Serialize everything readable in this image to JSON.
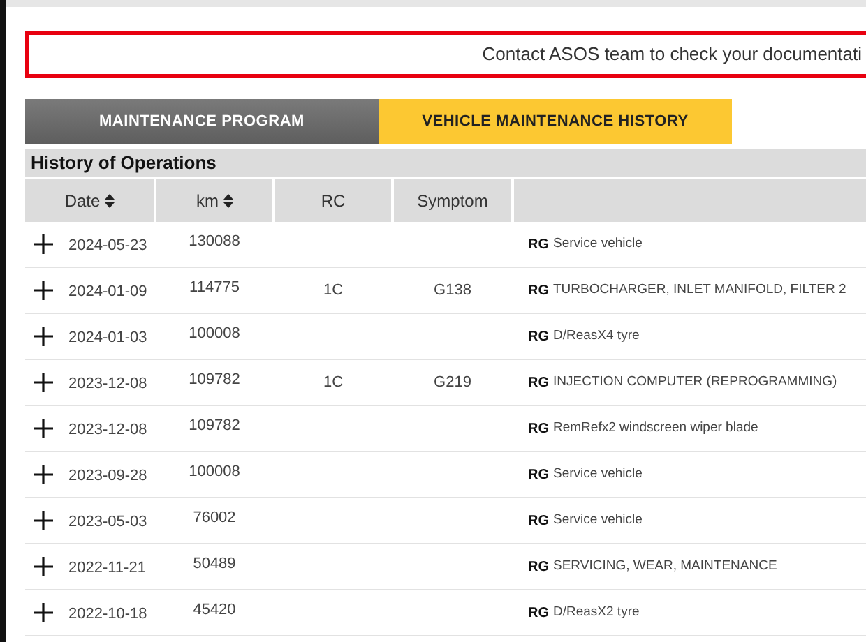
{
  "notice": "Contact ASOS team to check your documentati",
  "tabs": [
    {
      "label": "MAINTENANCE PROGRAM",
      "selected": false
    },
    {
      "label": "VEHICLE MAINTENANCE HISTORY",
      "selected": true
    }
  ],
  "section_title": "History of Operations",
  "table": {
    "columns": [
      {
        "label": "Date",
        "sortable": true
      },
      {
        "label": "km",
        "sortable": true
      },
      {
        "label": "RC",
        "sortable": false
      },
      {
        "label": "Symptom",
        "sortable": false
      }
    ],
    "rows": [
      {
        "date": "2024-05-23",
        "km": "130088",
        "rc": "",
        "symptom": "",
        "tag": "RG",
        "operation": "Service vehicle"
      },
      {
        "date": "2024-01-09",
        "km": "114775",
        "rc": "1C",
        "symptom": "G138",
        "tag": "RG",
        "operation": "TURBOCHARGER, INLET MANIFOLD, FILTER 2"
      },
      {
        "date": "2024-01-03",
        "km": "100008",
        "rc": "",
        "symptom": "",
        "tag": "RG",
        "operation": "D/ReasX4 tyre"
      },
      {
        "date": "2023-12-08",
        "km": "109782",
        "rc": "1C",
        "symptom": "G219",
        "tag": "RG",
        "operation": "INJECTION COMPUTER (REPROGRAMMING)"
      },
      {
        "date": "2023-12-08",
        "km": "109782",
        "rc": "",
        "symptom": "",
        "tag": "RG",
        "operation": "RemRefx2 windscreen wiper blade"
      },
      {
        "date": "2023-09-28",
        "km": "100008",
        "rc": "",
        "symptom": "",
        "tag": "RG",
        "operation": "Service vehicle"
      },
      {
        "date": "2023-05-03",
        "km": "76002",
        "rc": "",
        "symptom": "",
        "tag": "RG",
        "operation": "Service vehicle"
      },
      {
        "date": "2022-11-21",
        "km": "50489",
        "rc": "",
        "symptom": "",
        "tag": "RG",
        "operation": "SERVICING, WEAR, MAINTENANCE"
      },
      {
        "date": "2022-10-18",
        "km": "45420",
        "rc": "",
        "symptom": "",
        "tag": "RG",
        "operation": "D/ReasX2 tyre"
      }
    ]
  }
}
